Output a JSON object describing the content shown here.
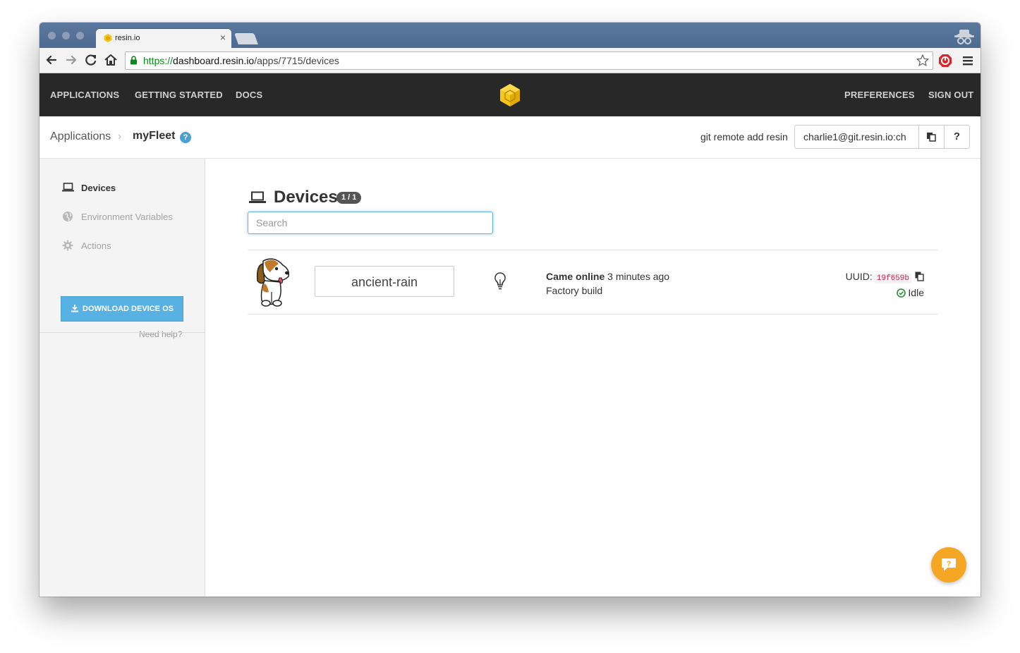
{
  "browser": {
    "tab_title": "resin.io",
    "url_scheme": "https://",
    "url_host": "dashboard.resin.io",
    "url_path": "/apps/7715/devices"
  },
  "header": {
    "nav_left": [
      "APPLICATIONS",
      "GETTING STARTED",
      "DOCS"
    ],
    "nav_right": [
      "PREFERENCES",
      "SIGN OUT"
    ],
    "logo": "resin-cube-logo"
  },
  "breadcrumb": {
    "root": "Applications",
    "current": "myFleet",
    "help": "?"
  },
  "git": {
    "label": "git remote add resin",
    "remote": "charlie1@git.resin.io:ch",
    "help": "?"
  },
  "sidebar": {
    "items": [
      {
        "label": "Devices",
        "icon": "laptop-icon",
        "active": true
      },
      {
        "label": "Environment Variables",
        "icon": "globe-icon",
        "active": false
      },
      {
        "label": "Actions",
        "icon": "gear-icon",
        "active": false
      }
    ],
    "download_label": "DOWNLOAD DEVICE OS",
    "need_help": "Need help?"
  },
  "main": {
    "title": "Devices",
    "count_badge": "1 / 1",
    "search_placeholder": "Search",
    "devices": [
      {
        "name": "ancient-rain",
        "status_bold": "Came online",
        "status_rest": "3 minutes ago",
        "build": "Factory build",
        "uuid_label": "UUID:",
        "uuid": "19f659b",
        "state": "Idle"
      }
    ]
  },
  "colors": {
    "header_bg": "#282828",
    "accent_blue": "#58b1e3",
    "logo_yellow": "#f5c51a",
    "chat_orange": "#f5a623",
    "idle_green": "#2e8b3a",
    "uuid_red": "#c7254e"
  }
}
